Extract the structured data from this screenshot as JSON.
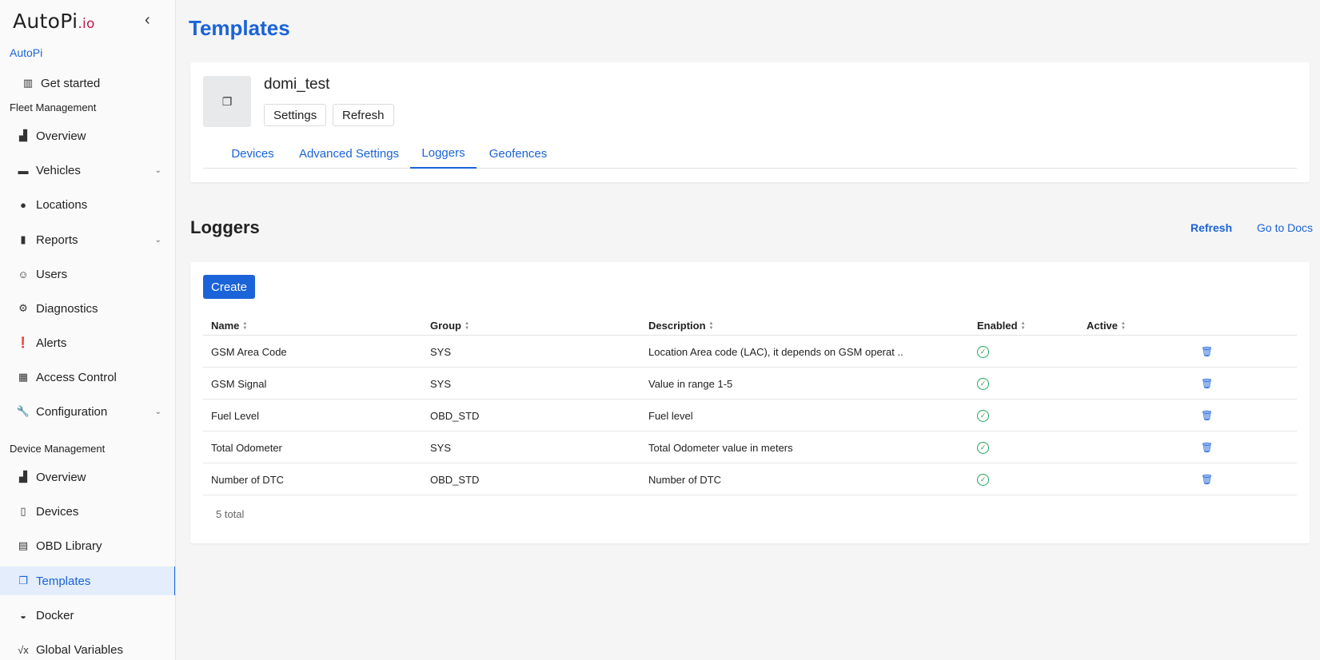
{
  "brand": {
    "name": "AutoPi",
    "suffix": ".io"
  },
  "sidebar": {
    "org": "AutoPi",
    "get_started": "Get started",
    "fleet_label": "Fleet Management",
    "fleet_items": [
      {
        "label": "Overview",
        "icon": "chart-icon"
      },
      {
        "label": "Vehicles",
        "icon": "car-icon"
      },
      {
        "label": "Locations",
        "icon": "pin-icon"
      },
      {
        "label": "Reports",
        "icon": "file-icon"
      },
      {
        "label": "Users",
        "icon": "users-icon"
      },
      {
        "label": "Diagnostics",
        "icon": "engine-icon"
      },
      {
        "label": "Alerts",
        "icon": "alert-icon"
      },
      {
        "label": "Access Control",
        "icon": "access-icon"
      },
      {
        "label": "Configuration",
        "icon": "wrench-icon"
      }
    ],
    "device_label": "Device Management",
    "device_items": [
      {
        "label": "Overview",
        "icon": "chart-icon"
      },
      {
        "label": "Devices",
        "icon": "devices-icon"
      },
      {
        "label": "OBD Library",
        "icon": "book-icon"
      },
      {
        "label": "Templates",
        "icon": "templates-icon"
      },
      {
        "label": "Docker",
        "icon": "docker-icon"
      },
      {
        "label": "Global Variables",
        "icon": "variable-icon"
      }
    ]
  },
  "page": {
    "title": "Templates"
  },
  "template": {
    "name": "domi_test",
    "settings_label": "Settings",
    "refresh_label": "Refresh",
    "tabs": [
      "Devices",
      "Advanced Settings",
      "Loggers",
      "Geofences"
    ]
  },
  "loggers": {
    "title": "Loggers",
    "refresh_label": "Refresh",
    "docs_label": "Go to Docs",
    "create_label": "Create",
    "columns": [
      "Name",
      "Group",
      "Description",
      "Enabled",
      "Active"
    ],
    "rows": [
      {
        "name": "GSM Area Code",
        "group": "SYS",
        "description": "Location Area code (LAC), it depends on GSM operat ..",
        "enabled": true
      },
      {
        "name": "GSM Signal",
        "group": "SYS",
        "description": "Value in range 1-5",
        "enabled": true
      },
      {
        "name": "Fuel Level",
        "group": "OBD_STD",
        "description": "Fuel level",
        "enabled": true
      },
      {
        "name": "Total Odometer",
        "group": "SYS",
        "description": "Total Odometer value in meters",
        "enabled": true
      },
      {
        "name": "Number of DTC",
        "group": "OBD_STD",
        "description": "Number of DTC",
        "enabled": true
      }
    ],
    "total": "5 total"
  },
  "colors": {
    "accent": "#1a63d8",
    "success": "#22a55a",
    "brand_io": "#c0174a"
  }
}
